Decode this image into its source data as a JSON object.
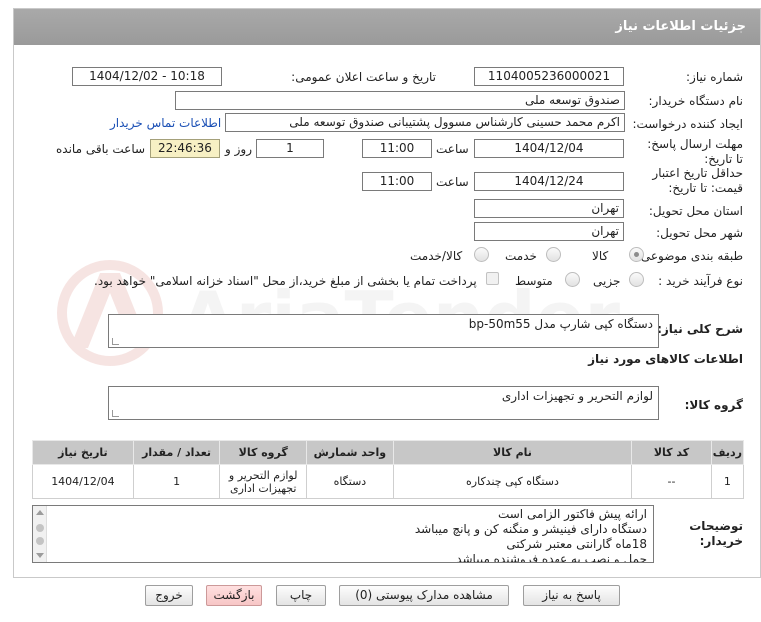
{
  "header": {
    "title": "جزئیات اطلاعات نیاز"
  },
  "need_number": {
    "label": "شماره نیاز:",
    "value": "1104005236000021"
  },
  "announce": {
    "label": "تاریخ و ساعت اعلان عمومی:",
    "value": "1404/12/02 - 10:18"
  },
  "buyer_org": {
    "label": "نام دستگاه خریدار:",
    "value": "صندوق توسعه ملی"
  },
  "creator": {
    "label": "ایجاد کننده درخواست:",
    "value": "اکرم محمد حسینی کارشناس مسوول پشتیبانی صندوق توسعه ملی",
    "contact_link": "اطلاعات تماس خریدار"
  },
  "deadline": {
    "label": "مهلت ارسال پاسخ: تا تاریخ:",
    "date": "1404/12/04",
    "time_label": "ساعت",
    "time": "11:00",
    "days": "1",
    "days_label": "روز و",
    "remaining": "22:46:36",
    "remaining_label": "ساعت باقی مانده"
  },
  "validity": {
    "label": "حداقل تاریخ اعتبار قیمت: تا تاریخ:",
    "date": "1404/12/24",
    "time_label": "ساعت",
    "time": "11:00"
  },
  "province": {
    "label": "استان محل تحویل:",
    "value": "تهران"
  },
  "city": {
    "label": "شهر محل تحویل:",
    "value": "تهران"
  },
  "category": {
    "label": "طبقه بندی موضوعی:",
    "options": [
      "کالا",
      "خدمت",
      "کالا/خدمت"
    ]
  },
  "process": {
    "label": "نوع فرآیند خرید :",
    "options": [
      "جزیی",
      "متوسط"
    ],
    "note": "پرداخت تمام یا بخشی از مبلغ خرید،از محل \"اسناد خزانه اسلامی\" خواهد بود."
  },
  "summary": {
    "label": "شرح کلی نیاز:",
    "value": "دستگاه کپی شارپ مدل bp-50m55"
  },
  "goods_info": {
    "title": "اطلاعات کالاهای مورد نیاز"
  },
  "goods_group": {
    "label": "گروه کالا:",
    "value": "لوازم التحریر و تجهیزات اداری"
  },
  "table": {
    "headers": [
      "ردیف",
      "کد کالا",
      "نام کالا",
      "واحد شمارش",
      "گروه کالا",
      "تعداد / مقدار",
      "تاریخ نیاز"
    ],
    "rows": [
      [
        "1",
        "--",
        "دستگاه کپی چندکاره",
        "دستگاه",
        "لوازم التحریر و تجهیزات اداری",
        "1",
        "1404/12/04"
      ]
    ]
  },
  "buyer_notes": {
    "label": "توضیحات خریدار:",
    "lines": [
      "ارائه پیش فاکتور الزامی است",
      "دستگاه دارای فینیشر و منگنه کن و پانچ میباشد",
      "18ماه گارانتی معتبر شرکتی",
      "حمل و نصب به عهده فروشنده میباشد"
    ]
  },
  "buttons": {
    "reply": "پاسخ به نیاز",
    "view_docs": "مشاهده مدارک پیوستی (0)",
    "print": "چاپ",
    "back": "بازگشت",
    "exit": "خروج"
  },
  "watermark": {
    "text": "AriaTender.net"
  }
}
